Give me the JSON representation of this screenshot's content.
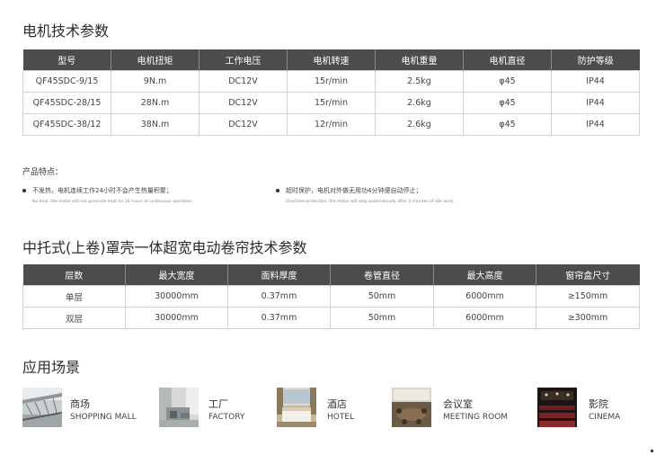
{
  "section1": {
    "title": "电机技术参数",
    "headers": [
      "型号",
      "电机扭矩",
      "工作电压",
      "电机转速",
      "电机重量",
      "电机直径",
      "防护等级"
    ],
    "rows": [
      [
        "QF45SDC-9/15",
        "9N.m",
        "DC12V",
        "15r/min",
        "2.5kg",
        "φ45",
        "IP44"
      ],
      [
        "QF45SDC-28/15",
        "28N.m",
        "DC12V",
        "15r/min",
        "2.6kg",
        "φ45",
        "IP44"
      ],
      [
        "QF45SDC-38/12",
        "38N.m",
        "DC12V",
        "12r/min",
        "2.6kg",
        "φ45",
        "IP44"
      ]
    ]
  },
  "features": {
    "heading": "产品特点：",
    "items": [
      {
        "cn": "不发热，电机连续工作24小时不会产生热量积聚；",
        "en": "No heat, the motor will not generate heat for 24 hours of continuous operation."
      },
      {
        "cn": "超时保护，电机对外做无用功4分钟便自动停止；",
        "en": "Overtime protection, the motor will stop automatically after 4 minutes of idle work."
      }
    ]
  },
  "section2": {
    "title": "中托式(上卷)罩壳一体超宽电动卷帘技术参数",
    "headers": [
      "层数",
      "最大宽度",
      "面料厚度",
      "卷管直径",
      "最大高度",
      "窗帘盒尺寸"
    ],
    "rows": [
      [
        "单层",
        "30000mm",
        "0.37mm",
        "50mm",
        "6000mm",
        "≥150mm"
      ],
      [
        "双层",
        "30000mm",
        "0.37mm",
        "50mm",
        "6000mm",
        "≥300mm"
      ]
    ]
  },
  "section3": {
    "title": "应用场景",
    "scenes": [
      {
        "cn": "商场",
        "en": "SHOPPING MALL",
        "icon": "shopping-mall-photo"
      },
      {
        "cn": "工厂",
        "en": "FACTORY",
        "icon": "factory-photo"
      },
      {
        "cn": "酒店",
        "en": "HOTEL",
        "icon": "hotel-photo"
      },
      {
        "cn": "会议室",
        "en": "MEETING ROOM",
        "icon": "meeting-room-photo"
      },
      {
        "cn": "影院",
        "en": "CINEMA",
        "icon": "cinema-photo"
      }
    ]
  },
  "colors": {
    "header_bg": "#4c4c4c",
    "border": "#d2d2d2"
  }
}
